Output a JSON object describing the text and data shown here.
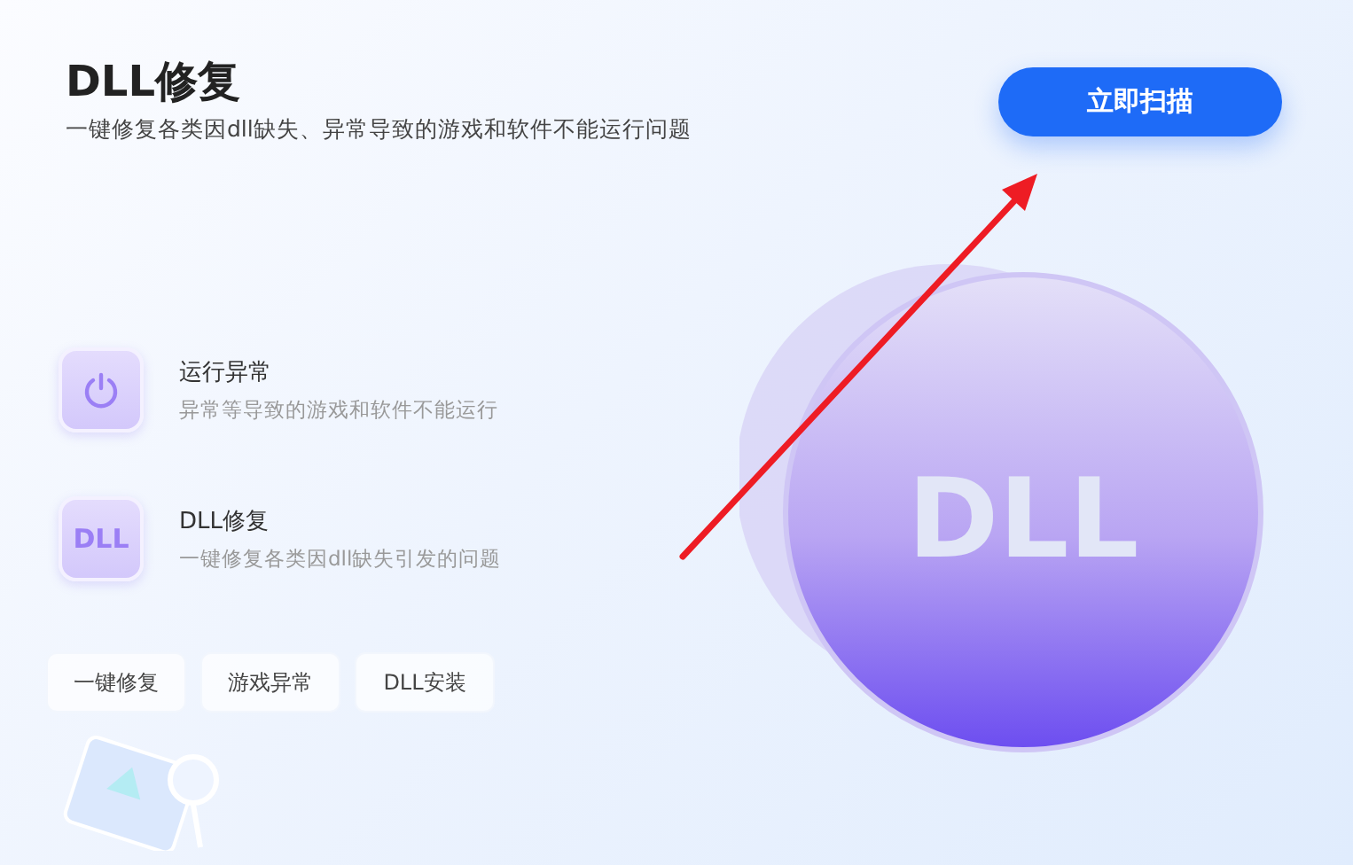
{
  "header": {
    "title": "DLL修复",
    "subtitle": "一键修复各类因dll缺失、异常导致的游戏和软件不能运行问题"
  },
  "scan_button": {
    "label": "立即扫描"
  },
  "features": [
    {
      "kind": "power",
      "title": "运行异常",
      "description": "异常等导致的游戏和软件不能运行"
    },
    {
      "kind": "dll",
      "icon_text": "DLL",
      "title": "DLL修复",
      "description": "一键修复各类因dll缺失引发的问题"
    }
  ],
  "quick_tags": [
    "一键修复",
    "游戏异常",
    "DLL安装"
  ],
  "coin": {
    "label": "DLL"
  }
}
